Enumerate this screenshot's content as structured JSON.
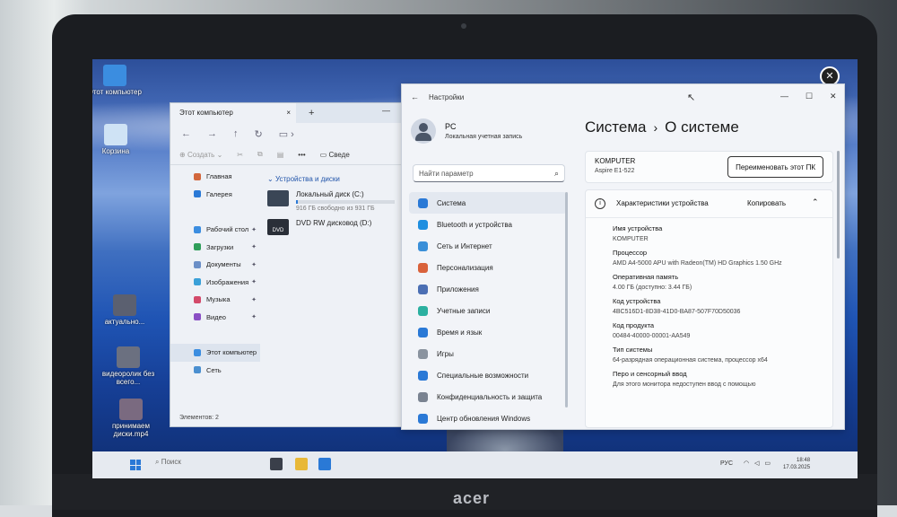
{
  "desktop": {
    "icons": [
      {
        "label": "Этот компьютер"
      },
      {
        "label": "Корзина"
      },
      {
        "label": "актуально..."
      },
      {
        "label": "видеоролик без всего..."
      },
      {
        "label": "принимаем диски.mp4"
      }
    ]
  },
  "laptop": {
    "brand": "acer"
  },
  "explorer": {
    "tab_title": "Этот компьютер",
    "tab_close": "×",
    "new_tab": "+",
    "toolbar": {
      "create": "Создать",
      "details": "Сведе"
    },
    "sidebar": {
      "home": "Главная",
      "gallery": "Галерея",
      "desktop": "Рабочий стол",
      "downloads": "Загрузки",
      "documents": "Документы",
      "images": "Изображения",
      "music": "Музыка",
      "video": "Видео",
      "this_pc": "Этот компьютер",
      "network": "Сеть"
    },
    "section_title": "Устройства и диски",
    "drives": [
      {
        "name": "Локальный диск (C:)",
        "info": "916 ГБ свободно из 931 ГБ",
        "used_fraction": 0.02
      },
      {
        "name": "DVD RW дисковод (D:)",
        "badge": "DVD"
      }
    ],
    "status": "Элементов: 2"
  },
  "settings": {
    "window_title": "Настройки",
    "profile": {
      "name": "PC",
      "type": "Локальная учетная запись"
    },
    "search_placeholder": "Найти параметр",
    "nav": [
      {
        "label": "Система",
        "color": "#2a79d6"
      },
      {
        "label": "Bluetooth и устройства",
        "color": "#1f8fe0"
      },
      {
        "label": "Сеть и Интернет",
        "color": "#3a8fd8"
      },
      {
        "label": "Персонализация",
        "color": "#d9623b"
      },
      {
        "label": "Приложения",
        "color": "#4b6fb4"
      },
      {
        "label": "Учетные записи",
        "color": "#2bb0a0"
      },
      {
        "label": "Время и язык",
        "color": "#2a79d6"
      },
      {
        "label": "Игры",
        "color": "#8a939f"
      },
      {
        "label": "Специальные возможности",
        "color": "#2a79d6"
      },
      {
        "label": "Конфиденциальность и защита",
        "color": "#7a8391"
      },
      {
        "label": "Центр обновления Windows",
        "color": "#2a79d6"
      }
    ],
    "breadcrumb": {
      "parent": "Система",
      "separator": "›",
      "current": "О системе"
    },
    "device": {
      "name": "KOMPUTER",
      "model": "Aspire E1-522",
      "rename_button": "Переименовать этот ПК"
    },
    "specs_card": {
      "title": "Характеристики устройства",
      "copy_button": "Копировать",
      "items": [
        {
          "key": "Имя устройства",
          "value": "KOMPUTER"
        },
        {
          "key": "Процессор",
          "value": "AMD A4-5000 APU with Radeon(TM) HD Graphics 1.50 GHz"
        },
        {
          "key": "Оперативная память",
          "value": "4.00 ГБ (доступно: 3.44 ГБ)"
        },
        {
          "key": "Код устройства",
          "value": "4BC516D1-8D38-41D0-BA87-507F70D50036"
        },
        {
          "key": "Код продукта",
          "value": "00484-40000-00001-AA549"
        },
        {
          "key": "Тип системы",
          "value": "64-разрядная операционная система, процессор x64"
        },
        {
          "key": "Перо и сенсорный ввод",
          "value": "Для этого монитора недоступен ввод с помощью"
        }
      ]
    }
  },
  "taskbar": {
    "search_placeholder": "Поиск",
    "language": "РУС",
    "time": "18:48",
    "date": "17.03.2025"
  }
}
